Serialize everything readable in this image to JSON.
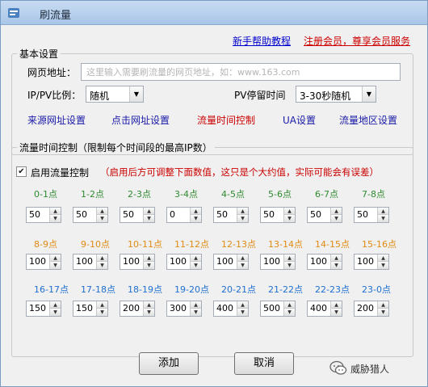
{
  "window": {
    "title": "刷流量"
  },
  "links": {
    "help": "新手帮助教程",
    "register": "注册会员，尊享会员服务"
  },
  "basic": {
    "legend": "基本设置",
    "url_label": "网页地址：",
    "url_placeholder": "这里输入需要刷流量的网页地址，如：www.163.com",
    "ratio_label": "IP/PV比例：",
    "ratio_value": "随机",
    "stay_label": "PV停留时间",
    "stay_value": "3-30秒随机"
  },
  "tabs": [
    "来源网址设置",
    "点击网址设置",
    "流量时间控制",
    "UA设置",
    "流量地区设置"
  ],
  "control": {
    "legend": "流量时间控制（限制每个时间段的最高IP数）",
    "checkbox_label": "启用流量控制",
    "checked": true,
    "note": "（启用后方可调整下面数值，这只是个大约值，实际可能会有误差）"
  },
  "slots": [
    {
      "label": "0-1点",
      "value": "50"
    },
    {
      "label": "1-2点",
      "value": "50"
    },
    {
      "label": "2-3点",
      "value": "50"
    },
    {
      "label": "3-4点",
      "value": "0"
    },
    {
      "label": "4-5点",
      "value": "50"
    },
    {
      "label": "5-6点",
      "value": "50"
    },
    {
      "label": "6-7点",
      "value": "50"
    },
    {
      "label": "7-8点",
      "value": "50"
    },
    {
      "label": "8-9点",
      "value": "100"
    },
    {
      "label": "9-10点",
      "value": "100"
    },
    {
      "label": "10-11点",
      "value": "100"
    },
    {
      "label": "11-12点",
      "value": "100"
    },
    {
      "label": "12-13点",
      "value": "100"
    },
    {
      "label": "13-14点",
      "value": "100"
    },
    {
      "label": "14-15点",
      "value": "100"
    },
    {
      "label": "15-16点",
      "value": "100"
    },
    {
      "label": "16-17点",
      "value": "150"
    },
    {
      "label": "17-18点",
      "value": "150"
    },
    {
      "label": "18-19点",
      "value": "200"
    },
    {
      "label": "19-20点",
      "value": "300"
    },
    {
      "label": "20-21点",
      "value": "400"
    },
    {
      "label": "21-22点",
      "value": "500"
    },
    {
      "label": "22-23点",
      "value": "400"
    },
    {
      "label": "23-0点",
      "value": "200"
    }
  ],
  "row_colors": [
    "#2f8a2f",
    "#e08a12",
    "#1f6fd0"
  ],
  "buttons": {
    "add": "添加",
    "cancel": "取消"
  },
  "watermark": "威胁猎人"
}
